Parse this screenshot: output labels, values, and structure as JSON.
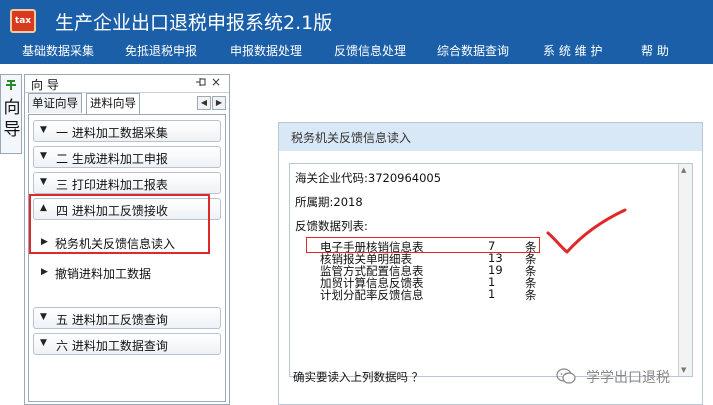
{
  "app": {
    "logo_text": "tax",
    "title": "生产企业出口退税申报系统2.1版"
  },
  "menu": [
    {
      "label": "基础数据采集"
    },
    {
      "label": "免抵退税申报"
    },
    {
      "label": "申报数据处理"
    },
    {
      "label": "反馈信息处理"
    },
    {
      "label": "综合数据查询"
    },
    {
      "label": "系 统 维 护"
    },
    {
      "label": "帮  助"
    }
  ],
  "vertical_tab": {
    "label": "向导",
    "pin_icon": "green-pin-icon"
  },
  "navigator": {
    "header_title": "向 导",
    "pin_symbol": "ꟷ¤",
    "close_symbol": "×",
    "tabs": [
      {
        "label": "单证向导",
        "active": false
      },
      {
        "label": "进料向导",
        "active": true
      }
    ],
    "sections": [
      {
        "label": "一  进料加工数据采集",
        "expanded": false
      },
      {
        "label": "二  生成进料加工申报",
        "expanded": false
      },
      {
        "label": "三  打印进料加工报表",
        "expanded": false
      },
      {
        "label": "四  进料加工反馈接收",
        "expanded": true
      },
      {
        "label": "五  进料加工反馈查询",
        "expanded": false
      },
      {
        "label": "六  进料加工数据查询",
        "expanded": false
      }
    ],
    "sub_items": [
      {
        "label": "税务机关反馈信息读入"
      },
      {
        "label": "撤销进料加工数据"
      }
    ]
  },
  "dialog": {
    "title": "税务机关反馈信息读入",
    "customs_code_label": "海关企业代码:",
    "customs_code": "3720964005",
    "period_label": "所属期:",
    "period": "2018",
    "list_label": "反馈数据列表:",
    "records": [
      {
        "name": "电子手册核销信息表",
        "count": "7",
        "unit": "条"
      },
      {
        "name": "核销报关单明细表",
        "count": "13",
        "unit": "条"
      },
      {
        "name": "监管方式配置信息表",
        "count": "19",
        "unit": "条"
      },
      {
        "name": "加贸计算信息反馈表",
        "count": "1",
        "unit": "条"
      },
      {
        "name": "计划分配率反馈信息",
        "count": "1",
        "unit": "条"
      }
    ],
    "confirm_text": "确实要读入上列数据吗 ？"
  },
  "watermark": {
    "text": "学学出口退税"
  },
  "colors": {
    "title_bar": "#1a5fa8",
    "annotation_red": "#e0282a"
  }
}
